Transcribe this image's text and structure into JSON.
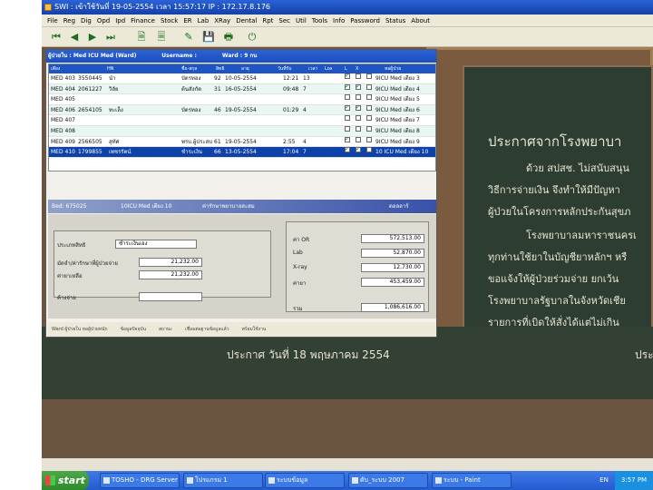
{
  "window_title": "SWI : ",
  "title_parts": [
    "เข้าใช้วันที่ 19-05-2554 เวลา 15:57:17 IP : 172.17.8.176"
  ],
  "menu": [
    "File",
    "Reg",
    "Dig",
    "Opd",
    "Ipd",
    "Finance",
    "Stock",
    "ER",
    "Lab",
    "XRay",
    "Dental",
    "Rpt",
    "Sec",
    "Util",
    "Tools",
    "Info",
    "Password",
    "Status",
    "About"
  ],
  "toolbar_icons": [
    "first-icon",
    "prev-icon",
    "next-icon",
    "last-icon",
    "new-document-icon",
    "list-document-icon",
    "edit-icon",
    "save-icon",
    "print-icon",
    "exit-icon"
  ],
  "inner_window": {
    "ward_label": "ผู้ป่วยใน : Med ICU Med (Ward)",
    "username_label": "Username : ",
    "ward_code": "Ward : 9 กน",
    "grid_headers": [
      "เตียง",
      "HN",
      "ชื่อ-สกุล",
      "สิทธิ",
      "อายุ",
      "วันที่รับ",
      "เวลา",
      "Los",
      "L",
      "X",
      "หอผู้ป่วย"
    ],
    "rows": [
      {
        "bed": "MED 403",
        "hn": "3550445",
        "name": "นำ",
        "right": "บัตรทอง",
        "age": "92",
        "admit": "10-05-2554",
        "time": "12:21",
        "los": "13",
        "l": true,
        "x": false,
        "ward": "9ICU Med เตียง 3"
      },
      {
        "bed": "MED 404",
        "hn": "2061227",
        "name": "วิลัย",
        "right": "ต้นสังกัด",
        "age": "31",
        "admit": "16-05-2554",
        "time": "09:48",
        "los": "7",
        "l": true,
        "x": true,
        "ward": "9ICU Med เตียง 4"
      },
      {
        "bed": "MED 405",
        "hn": "",
        "name": "",
        "right": "",
        "age": "",
        "admit": "",
        "time": "",
        "los": "",
        "l": false,
        "x": false,
        "ward": "9ICU Med เตียง 5"
      },
      {
        "bed": "MED 406",
        "hn": "2654105",
        "name": "ทะเล็ง",
        "right": "บัตรทอง",
        "age": "46",
        "admit": "19-05-2554",
        "time": "01:29",
        "los": "4",
        "l": true,
        "x": true,
        "ward": "9ICU Med เตียง 6"
      },
      {
        "bed": "MED 407",
        "hn": "",
        "name": "",
        "right": "",
        "age": "",
        "admit": "",
        "time": "",
        "los": "",
        "l": false,
        "x": false,
        "ward": "9ICU Med เตียง 7"
      },
      {
        "bed": "MED 408",
        "hn": "",
        "name": "",
        "right": "",
        "age": "",
        "admit": "",
        "time": "",
        "los": "",
        "l": false,
        "x": false,
        "ward": "9ICU Med เตียง 8"
      },
      {
        "bed": "MED 409",
        "hn": "2566505",
        "name": "สุทัศ",
        "right": "พรบ.ผู้ประสบ",
        "age": "61",
        "admit": "19-05-2554",
        "time": "2:55",
        "los": "4",
        "l": true,
        "x": false,
        "ward": "9ICU Med เตียง 9"
      },
      {
        "bed": "MED 410",
        "hn": "1799855",
        "name": "เพชรรัตน์",
        "right": "ชำระเงิน",
        "age": "66",
        "admit": "13-05-2554",
        "time": "17:04",
        "los": "7",
        "l": true,
        "x": true,
        "ward": "10 ICU Med เตียง 10"
      }
    ],
    "panel_header": [
      "Bed: 675025",
      "10ICU Med เตียง 10",
      "ค่ารักษาพยาบาลสะสม",
      "ดอลลาร์"
    ],
    "left_fields": [
      {
        "label": "ประเภทสิทธิ",
        "value": "ชำระเงินเอง"
      },
      {
        "label": "มัดจำ/ค่ารักษาที่ผู้ป่วยจ่าย",
        "value": "21,232.00"
      },
      {
        "label": "ค่ายาเหลือ",
        "value": "21,232.00"
      },
      {
        "label": "ค้างจ่าย",
        "value": ""
      }
    ],
    "right_fields": [
      {
        "label": "ค่า OR",
        "value": "572,513.00"
      },
      {
        "label": "Lab",
        "value": "52,870.00"
      },
      {
        "label": "X-ray",
        "value": "12,730.00"
      },
      {
        "label": "ค่ายา",
        "value": "453,459.00"
      },
      {
        "label": "รวม",
        "value": "1,086,616.00"
      }
    ],
    "status": [
      "Ward ผู้ป่วยใน หอผู้ป่วยหนัก",
      "ข้อมูลปัจจุบัน",
      "สถานะ",
      "เชื่อมต่อฐานข้อมูลแล้ว",
      "พร้อมใช้งาน"
    ]
  },
  "board_text": {
    "heading": "ประกาศจากโรงพยาบา",
    "lines": [
      "ด้วย สปสช. ไม่สนับสนุน",
      "วิธีการจ่ายเงิน จึงทำให้มีปัญหา",
      "ผู้ป่วยในโครงการหลักประกันสุขภ",
      "โรงพยาบาลมหาราชนครเ",
      "ทุกท่านใช้ยาในบัญชียาหลักฯ หรื",
      "ขอแจ้งให้ผู้ป่วยร่วมจ่าย ยกเว้น",
      "โรงพยาบาลรัฐบาลในจังหวัดเชีย",
      "รายการที่เบิดให้สั่งได้แต่ไม่เกิน"
    ],
    "date_line": "ประกาศ วันที่ 18 พฤษภาคม 2554",
    "date_tail": "ประ"
  },
  "taskbar": {
    "start": "start",
    "items": [
      "TOSHO - DRG Server",
      "โปรแกรม 1",
      "ระบบข้อมูล",
      "ดับ_ระบบ 2007",
      "ระบบ - Paint"
    ],
    "lang": "EN",
    "time": "3:57 PM"
  }
}
